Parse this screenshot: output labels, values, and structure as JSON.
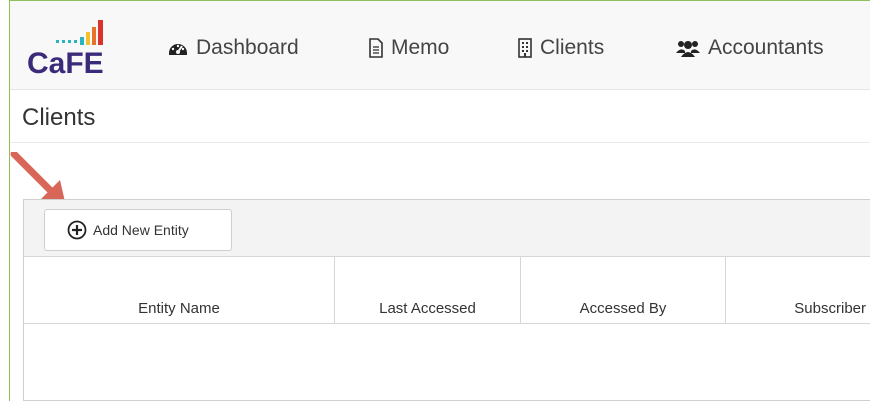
{
  "app": {
    "logo_text": "CaFE"
  },
  "nav": {
    "items": [
      {
        "label": "Dashboard",
        "icon": "dashboard-icon"
      },
      {
        "label": "Memo",
        "icon": "document-icon"
      },
      {
        "label": "Clients",
        "icon": "building-icon"
      },
      {
        "label": "Accountants",
        "icon": "users-icon"
      }
    ]
  },
  "page": {
    "title": "Clients"
  },
  "toolbar": {
    "add_label": "Add New Entity"
  },
  "table": {
    "columns": [
      "Entity Name",
      "Last Accessed",
      "Accessed By",
      "Subscriber"
    ]
  },
  "colors": {
    "logo_purple": "#3b2a7a",
    "logo_teal": "#2bb3c0",
    "logo_yellow": "#f2c12e",
    "logo_orange": "#e8722b",
    "logo_red": "#d9342b",
    "arrow": "#d8675a",
    "frame_green": "#8fbf5a"
  }
}
